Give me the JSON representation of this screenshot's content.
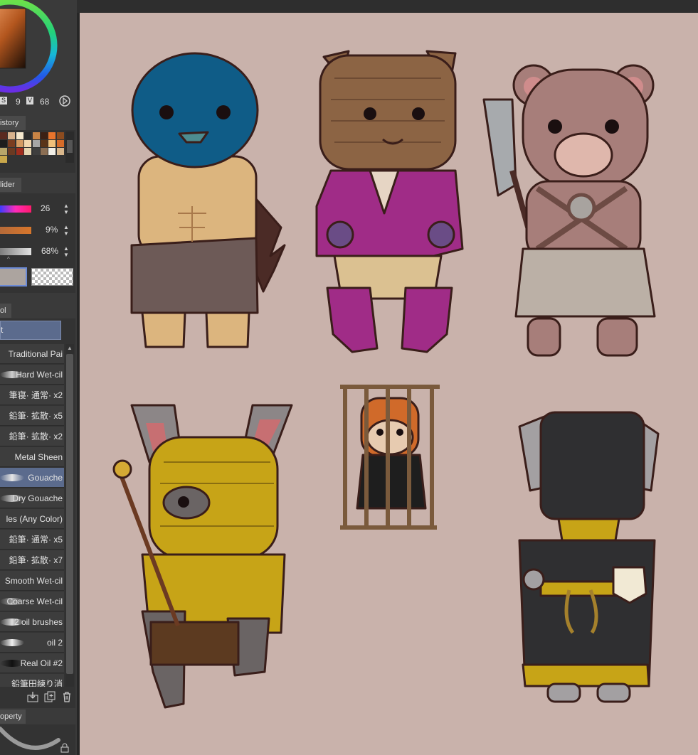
{
  "color_panel": {
    "hsv": {
      "s_label": "S",
      "s_value": "9",
      "v_label": "V",
      "v_value": "68"
    },
    "main_color": "#e7852b"
  },
  "history_tab": {
    "label": "istory"
  },
  "palette": {
    "rows": [
      [
        "#5a2a20",
        "#d7b28d",
        "#f4e7cd",
        "#2b2b2b",
        "#c98445",
        "#3c2014",
        "#e8742c",
        "#8d4c1f"
      ],
      [
        "#1d1d1d",
        "#7b3d20",
        "#d59b63",
        "#f3d7ae",
        "#a6a6a6",
        "#5a3418",
        "#f0c07a",
        "#d56b29"
      ],
      [
        "#b8a66a",
        "#6b3a22",
        "#a12d1d",
        "#e6d5b0",
        "#3e3e3e",
        "#8b6e53",
        "#f1efe7",
        "#d9b78c"
      ],
      [
        "#c9a84b",
        "#333",
        "#333",
        "#333",
        "#333",
        "#333",
        "#333",
        "#333"
      ]
    ]
  },
  "slider_tab": {
    "label": "lider"
  },
  "sliders": [
    {
      "name": "hue",
      "value": "26"
    },
    {
      "name": "saturation",
      "value": "9%"
    },
    {
      "name": "value",
      "value": "68%"
    }
  ],
  "tool_tab": {
    "label": "ol"
  },
  "subtool": {
    "label": "t"
  },
  "brushes": [
    {
      "label": "Traditional Pai",
      "stroke": ""
    },
    {
      "label": "Hard Wet-cil",
      "stroke": "#cfcfcf"
    },
    {
      "label": "筆寝· 通常· x2",
      "stroke": ""
    },
    {
      "label": "鉛筆· 拡散· x5",
      "stroke": ""
    },
    {
      "label": "鉛筆· 拡散· x2",
      "stroke": ""
    },
    {
      "label": "Metal Sheen",
      "stroke": ""
    },
    {
      "label": "Gouache",
      "stroke": "#e6e6e6"
    },
    {
      "label": "Dry Gouache",
      "stroke": "#bbbbbb"
    },
    {
      "label": "les (Any Color)",
      "stroke": ""
    },
    {
      "label": "鉛筆· 通常· x5",
      "stroke": ""
    },
    {
      "label": "鉛筆· 拡散· x7",
      "stroke": ""
    },
    {
      "label": "Smooth Wet-cil",
      "stroke": ""
    },
    {
      "label": "Coarse Wet-cil",
      "stroke": "#9a9a9a"
    },
    {
      "label": "2 oil brushes",
      "stroke": "#dddddd"
    },
    {
      "label": "oil 2",
      "stroke": "#f0f0f0"
    },
    {
      "label": "Real Oil #2",
      "stroke": "#111111"
    },
    {
      "label": "鉛筆田練り消",
      "stroke": ""
    }
  ],
  "selected_brush_index": 6,
  "property_tab": {
    "label": "operty"
  }
}
